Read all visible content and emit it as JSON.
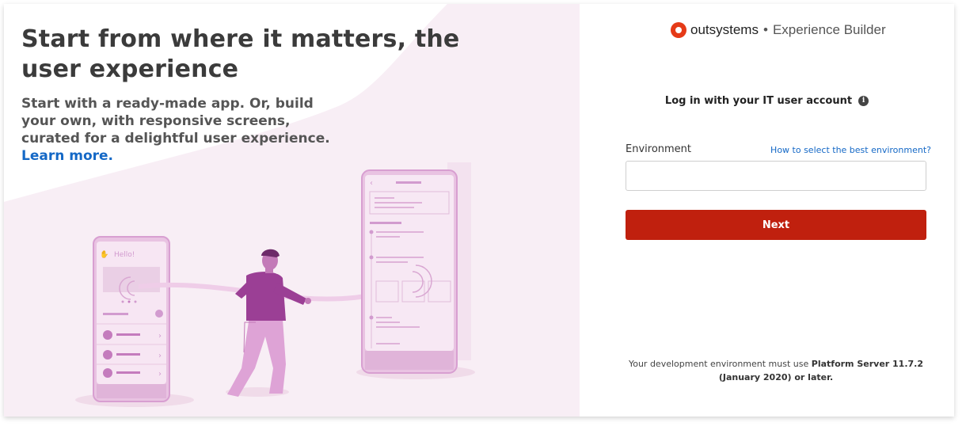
{
  "hero": {
    "headline": "Start from where it matters, the user experience",
    "subline": "Start with a ready-made app. Or, build your own, with responsive screens, curated for a delightful user experience.",
    "learn_more": "Learn more.",
    "phone_greeting": "Hello!"
  },
  "brand": {
    "logo_text": "outsystems",
    "separator": "•",
    "product": "Experience Builder",
    "accent_color": "#e53a17"
  },
  "login": {
    "title": "Log in with your IT user account",
    "info_icon": "info-icon",
    "environment_label": "Environment",
    "help_link": "How to select the best environment?",
    "environment_value": "",
    "environment_placeholder": "",
    "next_label": "Next",
    "next_color": "#c0200e"
  },
  "footnote": {
    "prefix": "Your development environment must use ",
    "bold": "Platform Server 11.7.2 (January 2020) or later."
  }
}
